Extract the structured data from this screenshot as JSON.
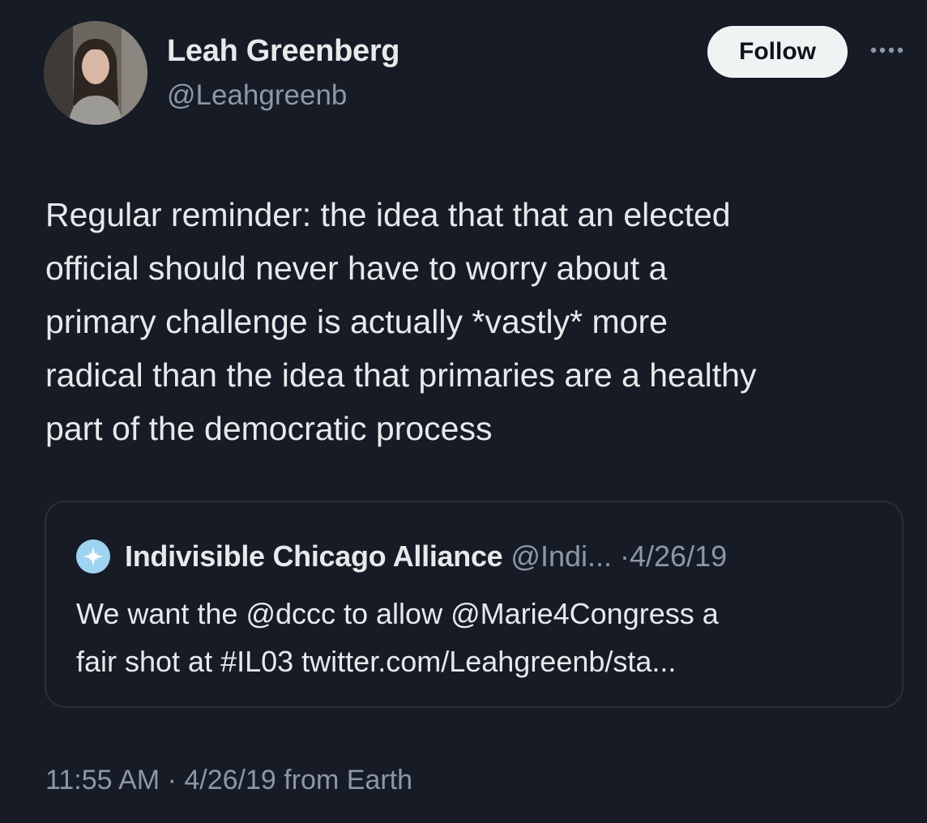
{
  "author": {
    "name": "Leah Greenberg",
    "handle": "@Leahgreenb",
    "avatar_icon": "profile-photo"
  },
  "actions": {
    "follow_label": "Follow",
    "more_icon": "more-horizontal-icon"
  },
  "tweet": {
    "lines": [
      "Regular reminder: the idea that that an elected",
      "official should never have to worry about a",
      "primary challenge is actually *vastly* more",
      "radical than the idea that primaries are a healthy",
      "part of the democratic process"
    ]
  },
  "quoted": {
    "name": "Indivisible Chicago Alliance",
    "handle": "@Indi...",
    "separator": "·",
    "date": "4/26/19",
    "avatar_icon": "star-logo-icon",
    "lines": [
      "We want the @dccc to allow @Marie4Congress a",
      "fair shot at #IL03 twitter.com/Leahgreenb/sta..."
    ]
  },
  "meta": {
    "time": "11:55 AM",
    "separator": "·",
    "date": "4/26/19",
    "source": "from Earth"
  },
  "colors": {
    "background": "#161b26",
    "text": "#e7e9ea",
    "muted": "#8b98a5",
    "follow_bg": "#eff3f4",
    "border": "#2a303a"
  }
}
